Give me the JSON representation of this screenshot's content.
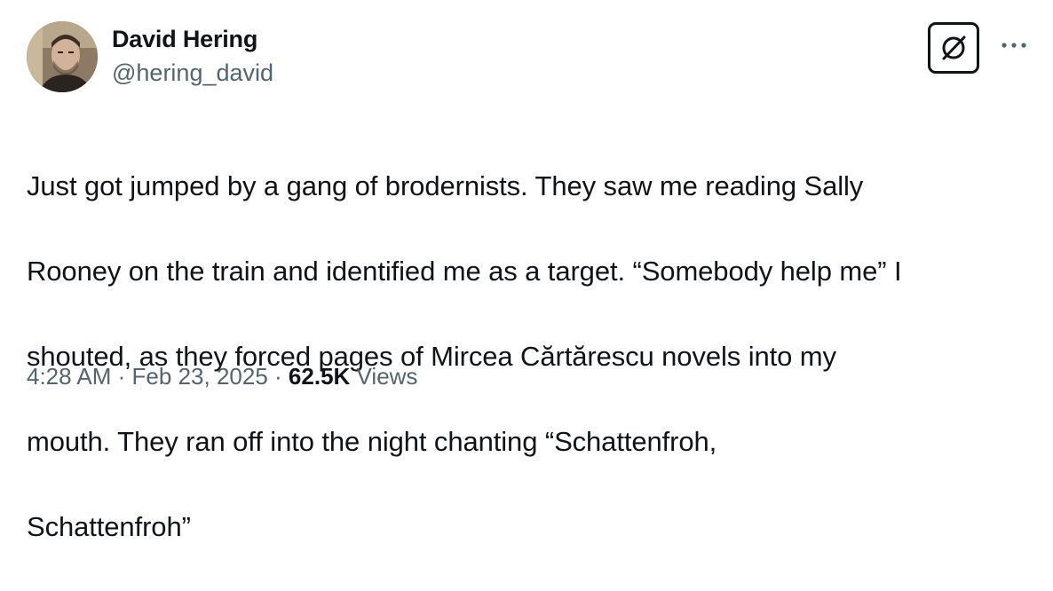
{
  "author": {
    "display_name": "David Hering",
    "handle": "@hering_david"
  },
  "tweet": {
    "lines": [
      "Just got jumped by a gang of brodernists. They saw me reading Sally",
      "Rooney on the train and identified me as a target.  “Somebody help me” I",
      "shouted, as they forced pages of Mircea Cărtărescu novels into my",
      "mouth.  They ran off into the night chanting “Schattenfroh,",
      "Schattenfroh”"
    ],
    "time": "4:28 AM",
    "separator": "·",
    "date": "Feb 23, 2025",
    "views_count": "62.5K",
    "views_label": "Views"
  },
  "icons": {
    "grok": "grok-icon",
    "more": "more-dots-icon"
  },
  "colors": {
    "text_primary": "#0f1419",
    "text_secondary": "#536471"
  }
}
